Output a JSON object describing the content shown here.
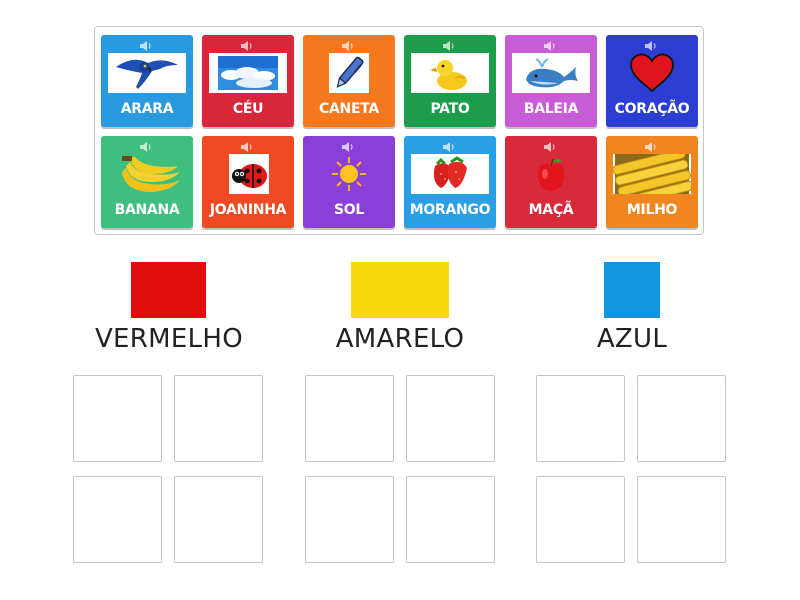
{
  "cards": [
    {
      "id": "arara",
      "label": "ARARA",
      "color": "#2a9ae0",
      "icon": "macaw-icon"
    },
    {
      "id": "ceu",
      "label": "CÉU",
      "color": "#d8273a",
      "icon": "sky-icon"
    },
    {
      "id": "caneta",
      "label": "CANETA",
      "color": "#f5781e",
      "icon": "pen-icon"
    },
    {
      "id": "pato",
      "label": "PATO",
      "color": "#1d9c4b",
      "icon": "duck-icon"
    },
    {
      "id": "baleia",
      "label": "BALEIA",
      "color": "#c85bd6",
      "icon": "whale-icon"
    },
    {
      "id": "coracao",
      "label": "CORAÇÃO",
      "color": "#2b3ed1",
      "icon": "heart-icon"
    },
    {
      "id": "banana",
      "label": "BANANA",
      "color": "#3fbf7f",
      "icon": "banana-icon"
    },
    {
      "id": "joaninha",
      "label": "JOANINHA",
      "color": "#ef4a24",
      "icon": "ladybug-icon"
    },
    {
      "id": "sol",
      "label": "SOL",
      "color": "#8b3fd9",
      "icon": "sun-icon"
    },
    {
      "id": "morango",
      "label": "MORANGO",
      "color": "#2b9fe6",
      "icon": "strawberry-icon"
    },
    {
      "id": "maca",
      "label": "MAÇÃ",
      "color": "#d82a3b",
      "icon": "apple-icon"
    },
    {
      "id": "milho",
      "label": "MILHO",
      "color": "#f2861e",
      "icon": "corn-icon"
    }
  ],
  "categories": [
    {
      "id": "vermelho",
      "title": "VERMELHO",
      "color": "#e00d0d"
    },
    {
      "id": "amarelo",
      "title": "AMARELO",
      "color": "#f7d90e"
    },
    {
      "id": "azul",
      "title": "AZUL",
      "color": "#1396dd"
    }
  ]
}
